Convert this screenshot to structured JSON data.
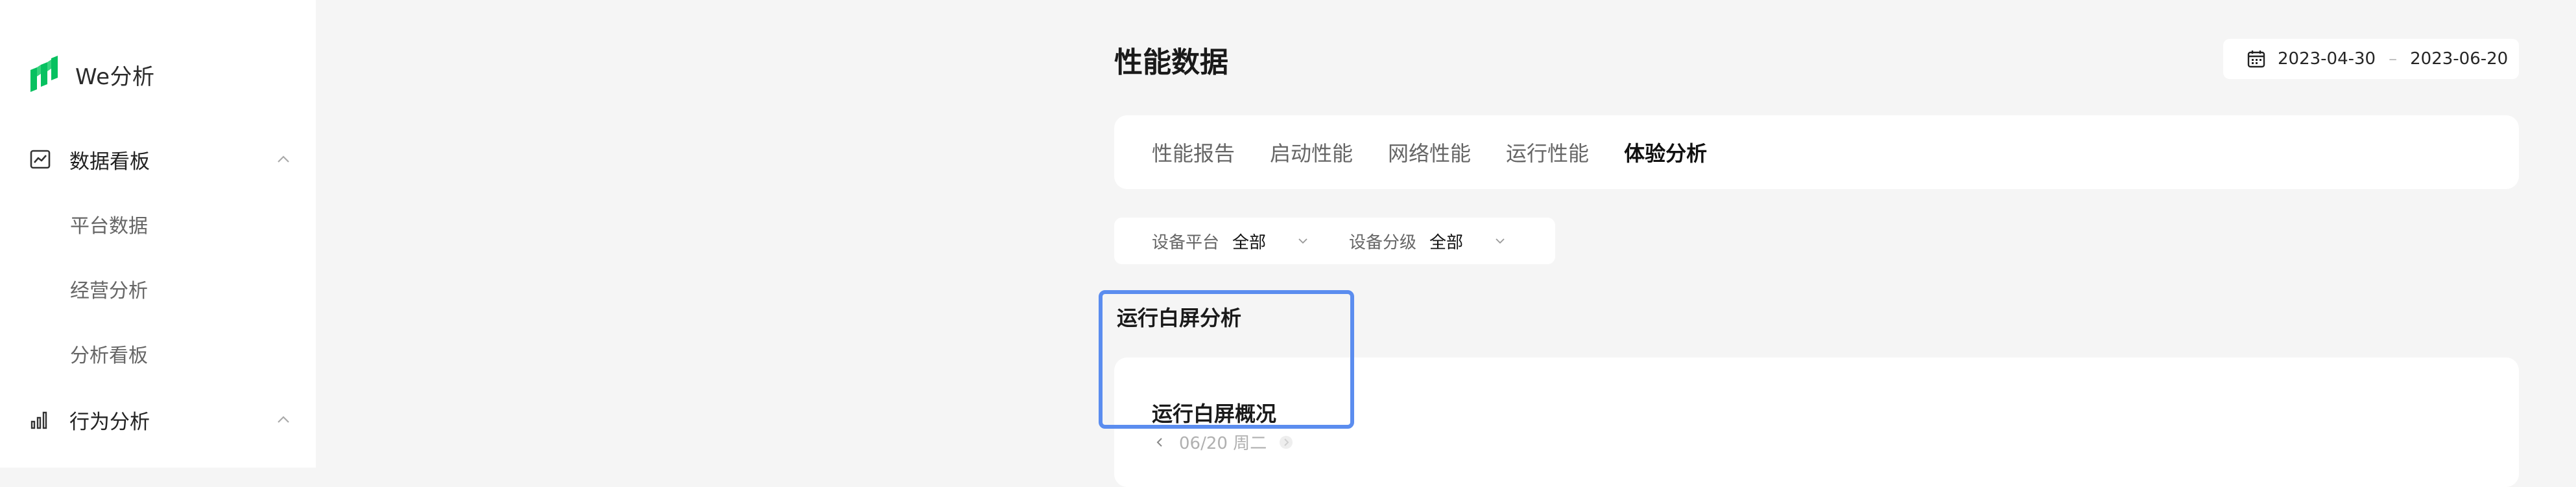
{
  "app": {
    "brand": "We分析"
  },
  "sidebar": {
    "groups": [
      {
        "label": "数据看板",
        "icon": "chart-board-icon",
        "expanded": true,
        "items": [
          {
            "label": "平台数据"
          },
          {
            "label": "经营分析"
          },
          {
            "label": "分析看板"
          }
        ]
      },
      {
        "label": "行为分析",
        "icon": "bar-chart-icon",
        "expanded": true,
        "items": []
      }
    ]
  },
  "header": {
    "title": "性能数据",
    "date_range": {
      "icon": "calendar-icon",
      "start": "2023-04-30",
      "separator": "–",
      "end": "2023-06-20"
    }
  },
  "tabs": [
    {
      "label": "性能报告",
      "active": false
    },
    {
      "label": "启动性能",
      "active": false
    },
    {
      "label": "网络性能",
      "active": false
    },
    {
      "label": "运行性能",
      "active": false
    },
    {
      "label": "体验分析",
      "active": true
    }
  ],
  "filters": [
    {
      "label": "设备平台",
      "value": "全部"
    },
    {
      "label": "设备分级",
      "value": "全部"
    }
  ],
  "section": {
    "heading": "运行白屏分析",
    "card_title": "运行白屏概况",
    "date_label": "06/20 周二"
  },
  "colors": {
    "brand_green": "#07c160",
    "highlight_blue": "#5b8def",
    "background": "#f5f5f5",
    "card": "#ffffff"
  }
}
